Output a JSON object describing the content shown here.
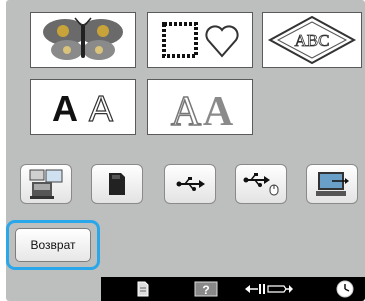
{
  "pattern_tiles": [
    {
      "name": "butterfly-pattern",
      "icon": "butterfly-icon"
    },
    {
      "name": "frame-pattern",
      "icon": "square-heart-frames-icon"
    },
    {
      "name": "monogram-pattern",
      "icon": "abc-monogram-icon",
      "text": "ABC"
    },
    {
      "name": "alphabet-pattern",
      "icon": "aa-alphabet-icon",
      "text": "AA"
    },
    {
      "name": "decorative-alphabet-pattern",
      "icon": "decorative-aa-icon",
      "text": "AA"
    }
  ],
  "source_buttons": [
    {
      "name": "machine-memory-button",
      "icon": "sewing-machine-memory-icon"
    },
    {
      "name": "memory-card-button",
      "icon": "memory-card-icon"
    },
    {
      "name": "usb-button",
      "icon": "usb-icon"
    },
    {
      "name": "usb-mouse-button",
      "icon": "usb-mouse-icon"
    },
    {
      "name": "computer-button",
      "icon": "computer-usb-icon"
    }
  ],
  "back_button": {
    "label": "Возврат"
  },
  "statusbar": {
    "items": [
      "page-icon",
      "help-icon",
      "thread-width-icon",
      "timer-icon"
    ]
  },
  "colors": {
    "highlight": "#2aa7ea",
    "panel": "#bdbfbe"
  }
}
